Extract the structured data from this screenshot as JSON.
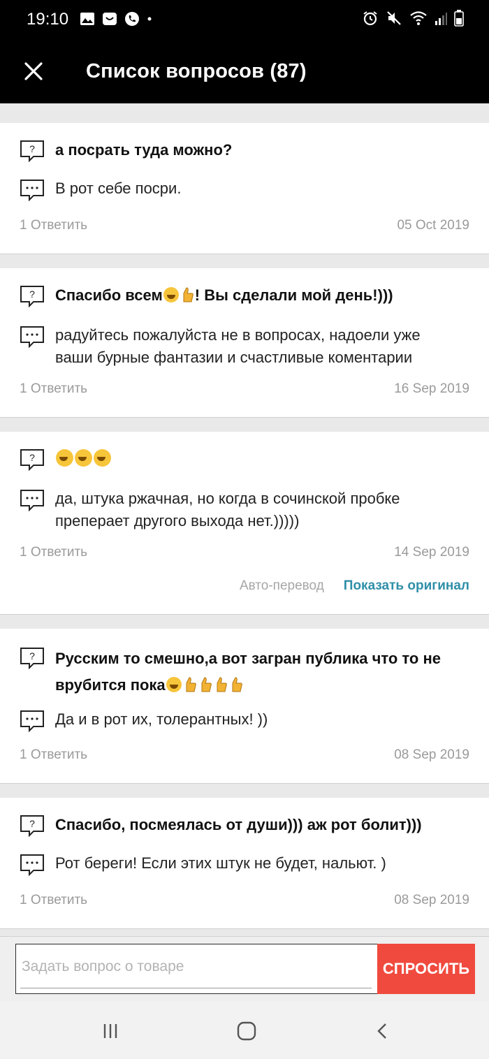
{
  "status": {
    "time": "19:10"
  },
  "header": {
    "title": "Список вопросов (87)",
    "close_icon": "close-icon"
  },
  "questions": [
    {
      "question": "а посрать туда можно?",
      "answer": "В рот себе посри.",
      "reply": "1 Ответить",
      "date": "05 Oct 2019"
    },
    {
      "question_a": "Спасибо всем",
      "question_b": "! Вы сделали мой день!)))",
      "answer_l1": "радуйтесь пожалуйста не в вопросах, надоели уже",
      "answer_l2": "ваши бурные  фантазии и счастливые  коментарии",
      "reply": "1 Ответить",
      "date": "16 Sep 2019"
    },
    {
      "answer_l1": "да, штука ржачная, но когда в сочинской пробке",
      "answer_l2": "преперает другого выхода нет.)))))",
      "reply": "1 Ответить",
      "date": "14 Sep 2019",
      "auto_translate": "Авто-перевод",
      "show_original": "Показать оригинал"
    },
    {
      "question_l1": "Русским то смешно,а вот загран публика что то не",
      "question_l2": "врубится пока",
      "answer": "Да и в рот их, толерантных! ))",
      "reply": "1 Ответить",
      "date": "08 Sep 2019"
    },
    {
      "question": "Спасибо, посмеялась от души))) аж рот болит)))",
      "answer": "Рот береги! Если этих штук не будет, нальют. )",
      "reply": "1 Ответить",
      "date": "08 Sep 2019"
    }
  ],
  "composer": {
    "placeholder": "Задать вопрос о товаре",
    "button": "СПРОСИТЬ"
  },
  "colors": {
    "accent": "#f04a3e",
    "link": "#2f8fa8",
    "header_bg": "#000000"
  }
}
